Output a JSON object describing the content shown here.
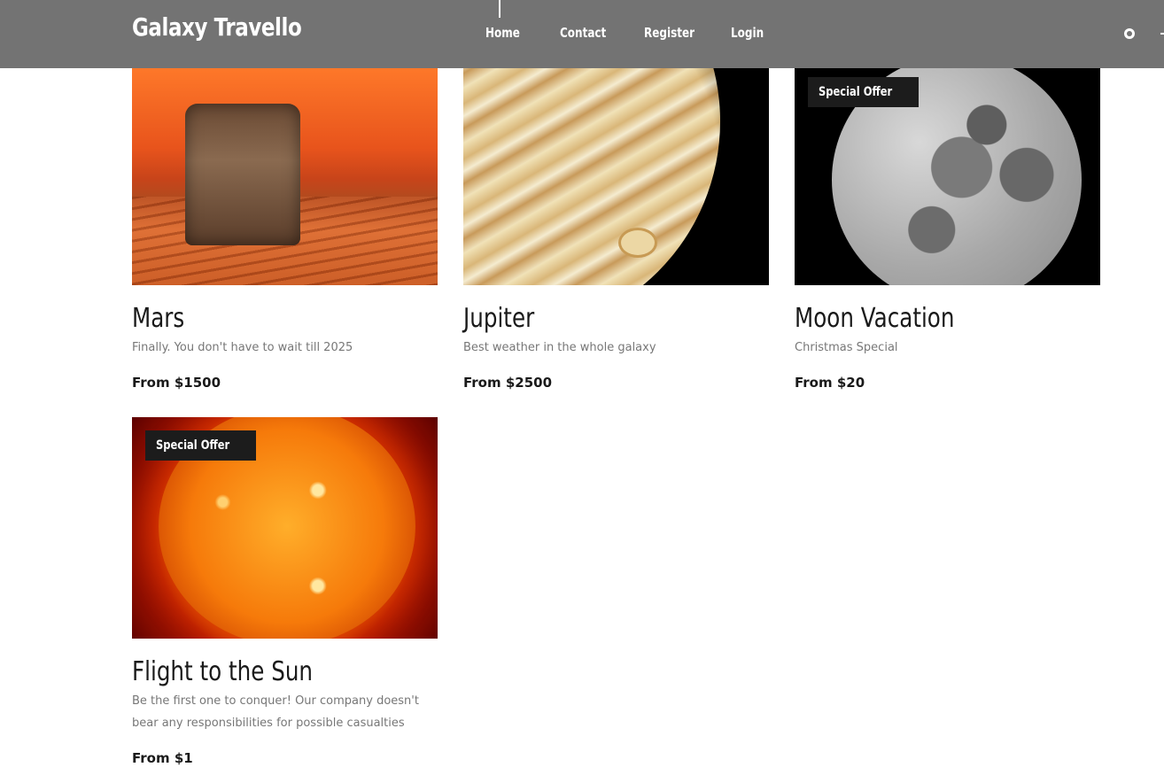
{
  "header": {
    "brand": "Galaxy Travello",
    "nav": [
      "Home",
      "Contact",
      "Register",
      "Login"
    ],
    "social_icon": "pinterest-icon"
  },
  "cards": [
    {
      "title": "Mars",
      "description": "Finally. You don't have to wait till 2025",
      "price": "From $1500",
      "badge": ""
    },
    {
      "title": "Jupiter",
      "description": "Best weather in the whole galaxy",
      "price": "From $2500",
      "badge": ""
    },
    {
      "title": "Moon Vacation",
      "description": "Christmas Special",
      "price": "From $20",
      "badge": "Special Offer"
    },
    {
      "title": "Flight to the Sun",
      "description": "Be the first one to conquer! Our company doesn't bear any responsibilities for possible casualties",
      "price": "From $1",
      "badge": "Special Offer"
    }
  ],
  "colors": {
    "header_bg": "#737373",
    "badge_bg": "#1c1c1c",
    "text_dark": "#1a1a1a",
    "text_muted": "#777777"
  }
}
